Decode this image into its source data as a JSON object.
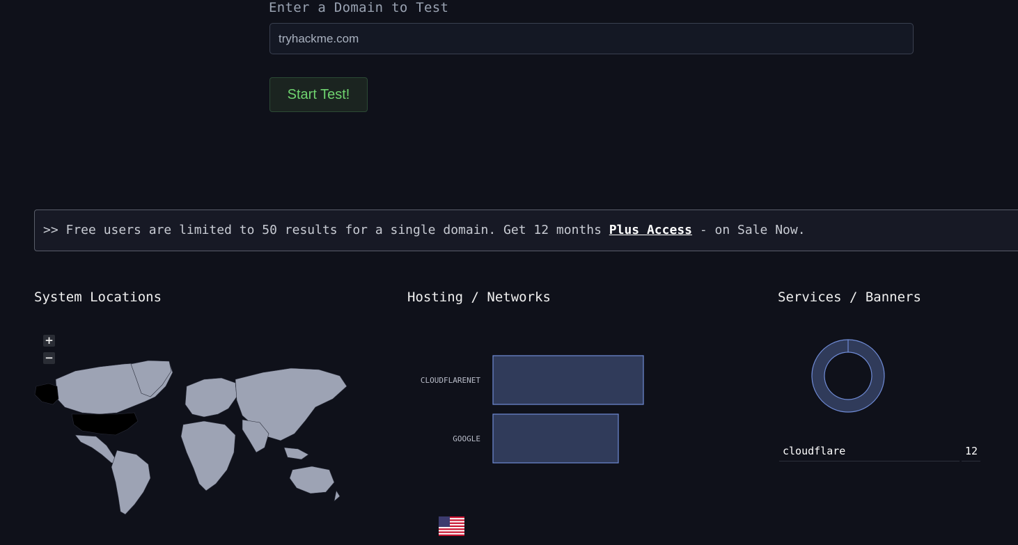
{
  "form": {
    "label": "Enter a Domain to Test",
    "input_value": "tryhackme.com",
    "button_label": "Start Test!"
  },
  "notice": {
    "prefix": ">> Free users are limited to 50 results for a single domain. Get 12 months ",
    "link_text": "Plus Access",
    "suffix": " - on Sale Now."
  },
  "sections": {
    "locations_title": "System Locations",
    "hosting_title": "Hosting / Networks",
    "services_title": "Services / Banners"
  },
  "map": {
    "zoom_in": "+",
    "zoom_out": "−",
    "highlighted_country": "United States",
    "land_color": "#9da3b4",
    "highlight_color": "#000000",
    "flag_icon": "us-flag-icon"
  },
  "chart_data": [
    {
      "type": "bar",
      "orientation": "horizontal",
      "categories": [
        "CLOUDFLARENET",
        "GOOGLE"
      ],
      "values": [
        6,
        5
      ],
      "title": "Hosting / Networks"
    },
    {
      "type": "pie",
      "categories": [
        "cloudflare"
      ],
      "values": [
        12
      ],
      "title": "Services / Banners"
    }
  ],
  "services": {
    "rows": [
      {
        "name": "cloudflare",
        "count": "12"
      }
    ]
  },
  "colors": {
    "background": "#0f111a",
    "accent_green": "#6fd36f",
    "bar_fill": "#303b5a",
    "bar_stroke": "#6f8bd6"
  }
}
